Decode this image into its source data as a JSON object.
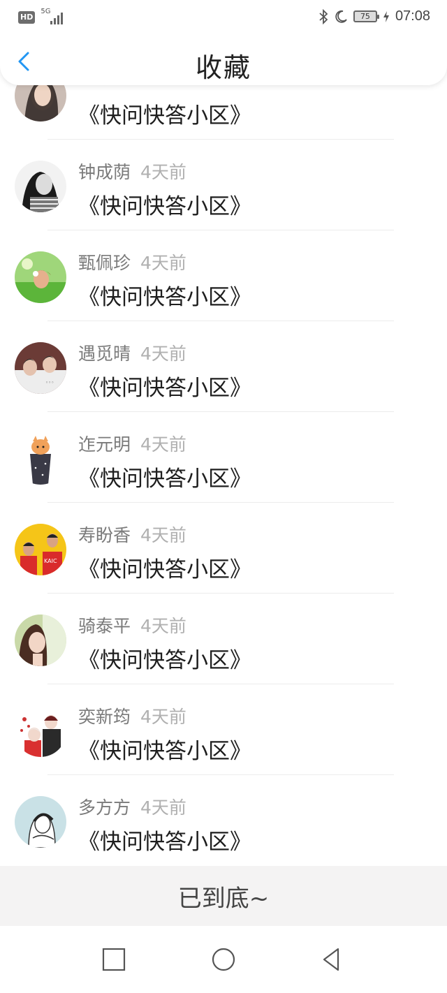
{
  "status_bar": {
    "hd": "HD",
    "network": "5G",
    "battery": "75",
    "time": "07:08"
  },
  "header": {
    "title": "收藏",
    "back_icon": "chevron-left-icon"
  },
  "items": [
    {
      "name": "",
      "time": "",
      "content": "《快问快答小区》"
    },
    {
      "name": "钟成荫",
      "time": "4天前",
      "content": "《快问快答小区》"
    },
    {
      "name": "甄佩珍",
      "time": "4天前",
      "content": "《快问快答小区》"
    },
    {
      "name": "遇觅晴",
      "time": "4天前",
      "content": "《快问快答小区》"
    },
    {
      "name": "迮元明",
      "time": "4天前",
      "content": "《快问快答小区》"
    },
    {
      "name": "寿盼香",
      "time": "4天前",
      "content": "《快问快答小区》"
    },
    {
      "name": "骑泰平",
      "time": "4天前",
      "content": "《快问快答小区》"
    },
    {
      "name": "奕新筠",
      "time": "4天前",
      "content": "《快问快答小区》"
    },
    {
      "name": "多方方",
      "time": "4天前",
      "content": "《快问快答小区》"
    }
  ],
  "footer": {
    "end_text": "已到底~"
  },
  "nav": {
    "recent": "square-icon",
    "home": "circle-icon",
    "back": "triangle-back-icon"
  },
  "colors": {
    "accent": "#2196f3",
    "name": "#7a7a7a",
    "time": "#b0b0b0"
  }
}
